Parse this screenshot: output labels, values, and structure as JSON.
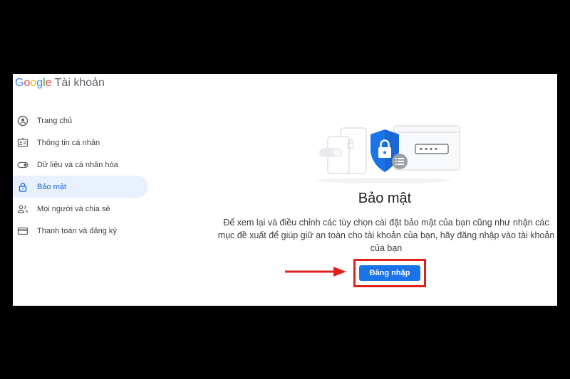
{
  "header": {
    "brand_letters": [
      {
        "ch": "G",
        "color": "#4285f4"
      },
      {
        "ch": "o",
        "color": "#ea4335"
      },
      {
        "ch": "o",
        "color": "#fbbc05"
      },
      {
        "ch": "g",
        "color": "#4285f4"
      },
      {
        "ch": "l",
        "color": "#34a853"
      },
      {
        "ch": "e",
        "color": "#ea4335"
      }
    ],
    "product": "Tài khoản"
  },
  "sidebar": {
    "items": [
      {
        "label": "Trang chủ",
        "icon": "home-person-icon"
      },
      {
        "label": "Thông tin cá nhân",
        "icon": "id-card-icon"
      },
      {
        "label": "Dữ liệu và cá nhân hóa",
        "icon": "toggle-icon"
      },
      {
        "label": "Bảo mật",
        "icon": "lock-icon",
        "active": true
      },
      {
        "label": "Mọi người và chia sẻ",
        "icon": "people-icon"
      },
      {
        "label": "Thanh toán và đăng ký",
        "icon": "credit-card-icon"
      }
    ]
  },
  "main": {
    "title": "Bảo mật",
    "description": "Để xem lại và điều chỉnh các tùy chọn cài đặt bảo mật của bạn cũng như nhận các mục đề xuất để giúp giữ an toàn cho tài khoản của bạn, hãy đăng nhập vào tài khoản của bạn",
    "signin_label": "Đăng nhập"
  },
  "colors": {
    "accent": "#1a73e8",
    "highlight_box": "#e0201b",
    "active_bg": "#e8f0fe"
  }
}
